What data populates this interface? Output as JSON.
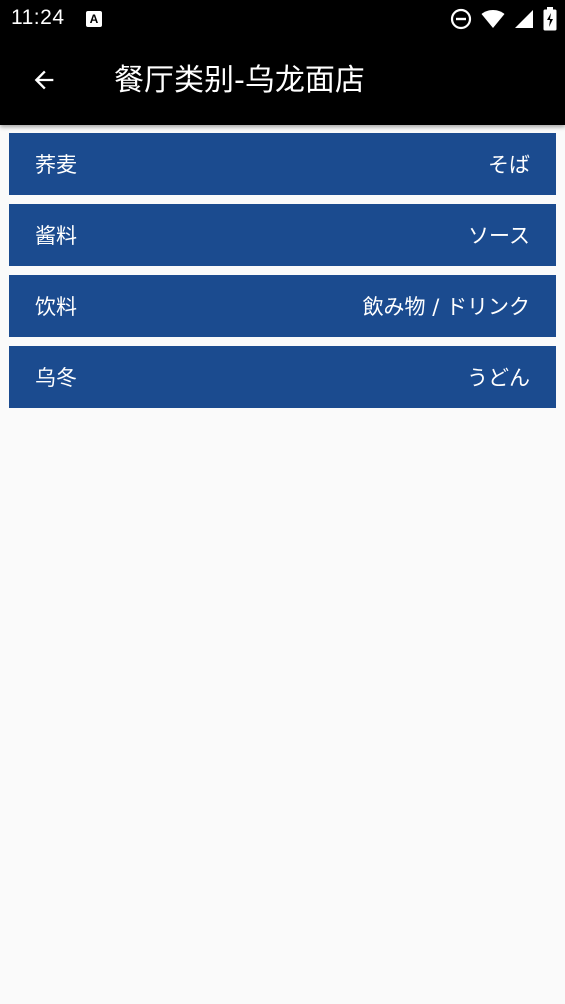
{
  "status_bar": {
    "time": "11:24",
    "notification_icon": "A",
    "icons": [
      "dnd-icon",
      "wifi-icon",
      "cell-signal-icon",
      "battery-charging-icon"
    ]
  },
  "app_bar": {
    "title": "餐厅类别-乌龙面店",
    "back_icon": "arrow-left-icon"
  },
  "categories": [
    {
      "label": "荞麦",
      "value": "そば"
    },
    {
      "label": "酱料",
      "value": "ソース"
    },
    {
      "label": "饮料",
      "value": "飲み物 / ドリンク"
    },
    {
      "label": "乌冬",
      "value": "うどん"
    }
  ],
  "colors": {
    "row_background": "#1b4b8f",
    "app_bar": "#000000",
    "page_background": "#fafafa"
  }
}
